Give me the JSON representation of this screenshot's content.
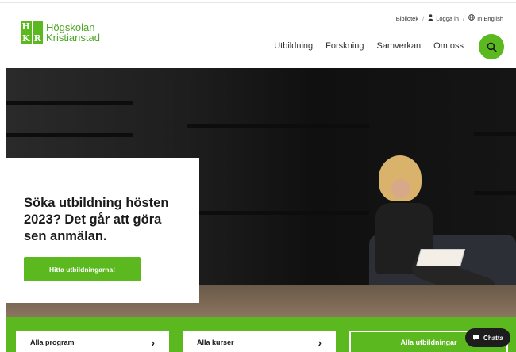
{
  "logo": {
    "mark": [
      "H",
      "",
      "K",
      "R"
    ],
    "line1": "Högskolan",
    "line2": "Kristianstad"
  },
  "utility": {
    "library": "Bibliotek",
    "login": "Logga in",
    "language": "In English"
  },
  "nav": {
    "items": [
      "Utbildning",
      "Forskning",
      "Samverkan",
      "Om oss"
    ],
    "search_icon": "search-icon"
  },
  "hero": {
    "headline": "Söka utbildning hösten 2023? Det går att göra sen anmälan.",
    "cta": "Hitta utbildningarna!"
  },
  "quicklinks": {
    "programs": "Alla program",
    "courses": "Alla kurser",
    "all": "Alla utbildningar"
  },
  "chat": {
    "label": "Chatta"
  },
  "colors": {
    "brand_green": "#5cb81f",
    "text": "#1a1a1a",
    "chat_bg": "#1d1d1d"
  }
}
